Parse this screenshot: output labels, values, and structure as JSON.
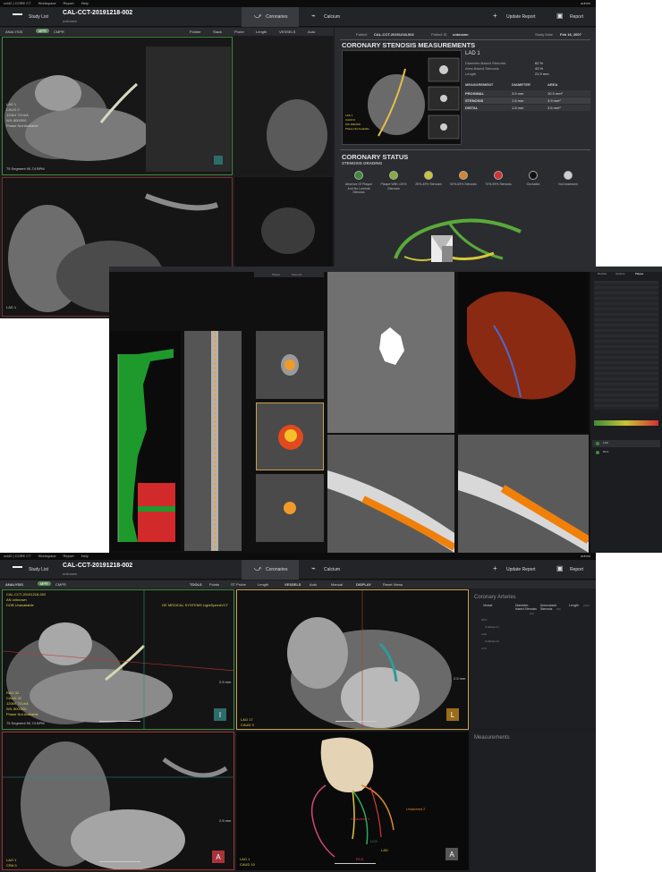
{
  "app": {
    "menu": [
      "cvi42 | CORE CT",
      "Workspace",
      "Report",
      "Help"
    ],
    "user": "admin",
    "study_list": "Study List",
    "study_id": "CAL-CCT-20191218-002",
    "study_sub": "unknown",
    "tabs": [
      "Coronaries",
      "Calcium"
    ],
    "update_report": "Update Report",
    "report": "Report"
  },
  "top": {
    "toolbar": [
      "ANALYSIS",
      "MPR",
      "CMPR"
    ],
    "tools": [
      "Pointer",
      "Stack",
      "Probe",
      "Length",
      "VESSELS",
      "Auto",
      "Manual"
    ],
    "patient_label": "Patient",
    "patient_value": "CAL-CCT-20191218-002",
    "patient_id_label": "Patient ID",
    "patient_id_value": "unknown",
    "study_date_label": "Study Date",
    "study_date_value": "Feb 16, 2007",
    "stenosis_title": "CORONARY STENOSIS MEASUREMENTS",
    "vessel_name": "LAD 1",
    "stats": [
      {
        "label": "Diameter-Based Stenosis",
        "value": "62 %"
      },
      {
        "label": "Area-Based Stenosis",
        "value": "43 %"
      },
      {
        "label": "Length",
        "value": "21.9 mm"
      }
    ],
    "meas_headers": [
      "MEASUREMENT",
      "DIAMETER",
      "AREA"
    ],
    "meas_rows": [
      {
        "name": "PROXIMAL",
        "diameter": "3.5 mm",
        "area": "10.3 mm²"
      },
      {
        "name": "STENOSIS",
        "diameter": "1.6 mm",
        "area": "3.9 mm²"
      },
      {
        "name": "DISTAL",
        "diameter": "1.8 mm",
        "area": "3.6 mm²"
      }
    ],
    "status_title": "CORONARY STATUS",
    "grading_title": "STENOSIS GRADING",
    "grading": [
      {
        "label": "Absence Of Plaque And No Luminal Stenosis",
        "color": "#3e8a3a"
      },
      {
        "label": "Plaque With <25% Stenosis",
        "color": "#7fb13a"
      },
      {
        "label": "25%-49% Stenosis",
        "color": "#c9c434"
      },
      {
        "label": "50%-69% Stenosis",
        "color": "#d9862b"
      },
      {
        "label": "70%-99% Stenosis",
        "color": "#d23131"
      },
      {
        "label": "Occluded",
        "color": "#111111"
      },
      {
        "label": "Not Assessed",
        "color": "#cfcfcf"
      }
    ],
    "viewport_info": [
      "LAD 1",
      "CAUD 0",
      "120kV 711mA",
      "W/L 800/300",
      "Phase Not Available"
    ],
    "segments_note": "75 Segment 90-74 BPM",
    "thumb_lines": [
      "LAD 1",
      "CAUD 0",
      "W/L 800/300",
      "Phase Not Available"
    ],
    "left_bottom_label": "LAD 1"
  },
  "middle": {
    "tabs": [
      "Plaque",
      "Stenosis"
    ],
    "right_tabs": [
      "Results",
      "Options",
      "Plaque"
    ],
    "legend": [
      "LAD",
      "RCA"
    ]
  },
  "bottom": {
    "toolbar": [
      "ANALYSIS",
      "MPR",
      "CMPR"
    ],
    "tools_label": "TOOLS",
    "tools": [
      "Points",
      "ST Probe",
      "Length"
    ],
    "vessels_label": "VESSELS",
    "vessel_tools": [
      "Auto",
      "Manual"
    ],
    "display_label": "DISPLAY",
    "reset": "Reset Views",
    "vp1_info": [
      "CAL-CCT-20191218-002",
      "AN unknown",
      "DOB Unavailable"
    ],
    "vendor": "GE MEDICAL SYSTEMS LightSpeedVCT",
    "vp1_bottom": [
      "RAO 32",
      "CAUD 32",
      "120kV 711mA",
      "W/L 800/300",
      "Phase Not Available",
      "75 Segment 90-74 BPM"
    ],
    "vp2_bottom": [
      "LAO 17",
      "CAUD 3"
    ],
    "vp3_bottom": [
      "LAO 1",
      "CRA 3"
    ],
    "vp4_bottom": [
      "LAO 1",
      "CAUD 10"
    ],
    "scale": "2.5 mm",
    "orientation": [
      "I",
      "L",
      "A",
      "A"
    ],
    "vessel_labels": [
      "Unlabeled 2",
      "Unlabeled 1",
      "LCX",
      "LAD",
      "RCA"
    ],
    "coronary_title": "Coronary Arteries",
    "col_headers": [
      "Vessel",
      "Diameter-based Stenosis",
      "Area-based Stenosis",
      "Length"
    ],
    "col_units": [
      "(%)",
      "(%)",
      "(mm)"
    ],
    "vessel_list": [
      "RCA",
      "Unlabeled 1",
      "LAD",
      "Unlabeled 2",
      "LCX"
    ],
    "measurements_title": "Measurements"
  }
}
